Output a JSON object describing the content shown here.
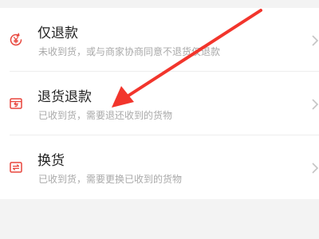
{
  "options": [
    {
      "title": "仅退款",
      "desc": "未收到货，或与商家协商同意不退货仅退款",
      "icon": "refund-yuan-icon"
    },
    {
      "title": "退货退款",
      "desc": "已收到货，需要退还收到的货物",
      "icon": "return-box-icon"
    },
    {
      "title": "换货",
      "desc": "已收到货，需要更换已收到的货物",
      "icon": "exchange-icon"
    }
  ],
  "colors": {
    "accent": "#e8453c",
    "arrow": "#f2352c",
    "title": "#222222",
    "desc": "#a9a9a9",
    "background": "#f3f3f3"
  }
}
